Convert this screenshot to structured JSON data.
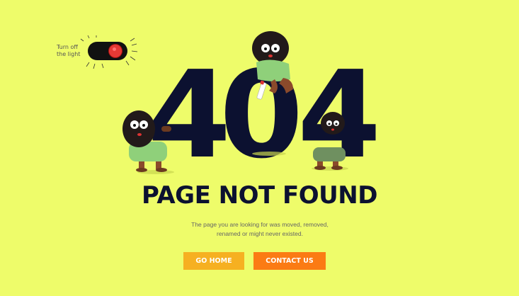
{
  "toggle": {
    "label_line1": "Turn off",
    "label_line2": "the light"
  },
  "error": {
    "code_digits": [
      "4",
      "0",
      "4"
    ]
  },
  "title": "PAGE NOT FOUND",
  "description": {
    "line1": "The page you are looking for was moved, removed,",
    "line2": "renamed or might never existed."
  },
  "buttons": {
    "home": "GO HOME",
    "contact": "CONTACT US"
  },
  "colors": {
    "background": "#eefc6a",
    "text_dark": "#0c1130",
    "home_button": "#f6b021",
    "contact_button": "#fb7b14"
  }
}
